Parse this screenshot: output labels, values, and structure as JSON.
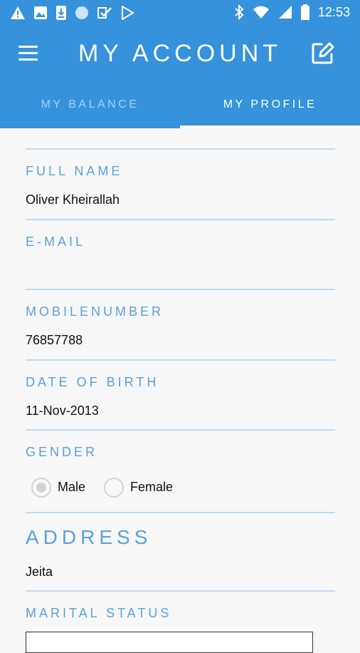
{
  "status_bar": {
    "time": "12:53",
    "left_icons": [
      "warning-icon",
      "image-icon",
      "download-icon",
      "circle-icon",
      "check-shield-icon",
      "play-store-icon"
    ],
    "right_icons": [
      "bluetooth-icon",
      "wifi-icon",
      "signal-icon",
      "battery-icon"
    ]
  },
  "toolbar": {
    "title": "MY ACCOUNT",
    "menu_icon": "hamburger-menu-icon",
    "edit_icon": "edit-icon"
  },
  "tabs": [
    {
      "label": "MY BALANCE",
      "selected": false
    },
    {
      "label": "MY PROFILE",
      "selected": true
    }
  ],
  "profile": {
    "full_name_label": "FULL NAME",
    "full_name_value": "Oliver Kheirallah",
    "email_label": "E-MAIL",
    "email_value": "",
    "mobile_label": "MOBILENUMBER",
    "mobile_value": "76857788",
    "dob_label": "DATE OF BIRTH",
    "dob_value": "11-Nov-2013",
    "gender_label": "GENDER",
    "gender_options": [
      "Male",
      "Female"
    ],
    "gender_selected": "Male",
    "address_label": "ADDRESS",
    "address_value": "Jeita",
    "marital_label": "MARITAL STATUS",
    "marital_value": ""
  },
  "colors": {
    "header_bg": "#3592db",
    "label_blue": "#5aa2db",
    "divider": "#bcdcf3",
    "page_bg": "#f7f7f7"
  }
}
